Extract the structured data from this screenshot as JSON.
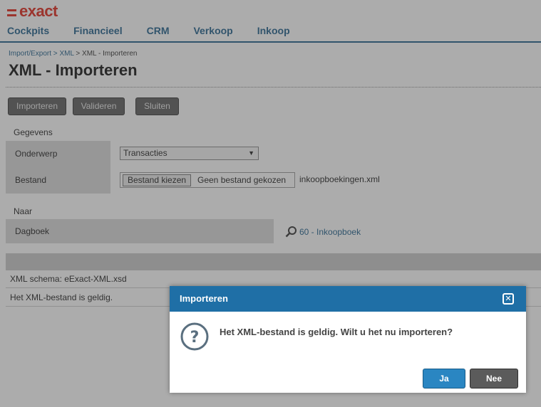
{
  "header": {
    "logo_text": "exact",
    "nav": [
      "Cockpits",
      "Financieel",
      "CRM",
      "Verkoop",
      "Inkoop"
    ]
  },
  "breadcrumb": {
    "item1": "Import/Export",
    "sep": " > ",
    "item2": "XML",
    "current": "XML - Importeren"
  },
  "page": {
    "title": "XML - Importeren"
  },
  "toolbar": {
    "import_label": "Importeren",
    "validate_label": "Valideren",
    "close_label": "Sluiten"
  },
  "form": {
    "section1": "Gegevens",
    "subject_label": "Onderwerp",
    "subject_value": "Transacties",
    "file_label": "Bestand",
    "file_button": "Bestand kiezen",
    "file_none": "Geen bestand gekozen",
    "file_name": "inkoopboekingen.xml",
    "section2": "Naar",
    "journal_label": "Dagboek",
    "journal_value": "60 - Inkoopboek"
  },
  "results": {
    "schema": "XML schema: eExact-XML.xsd",
    "valid": "Het XML-bestand is geldig."
  },
  "dialog": {
    "title": "Importeren",
    "message": "Het XML-bestand is geldig. Wilt u het nu importeren?",
    "yes_label": "Ja",
    "no_label": "Nee"
  },
  "colors": {
    "brand": "#e0271b",
    "nav": "#1f5f8b",
    "dialog_header": "#1f6fa6"
  }
}
